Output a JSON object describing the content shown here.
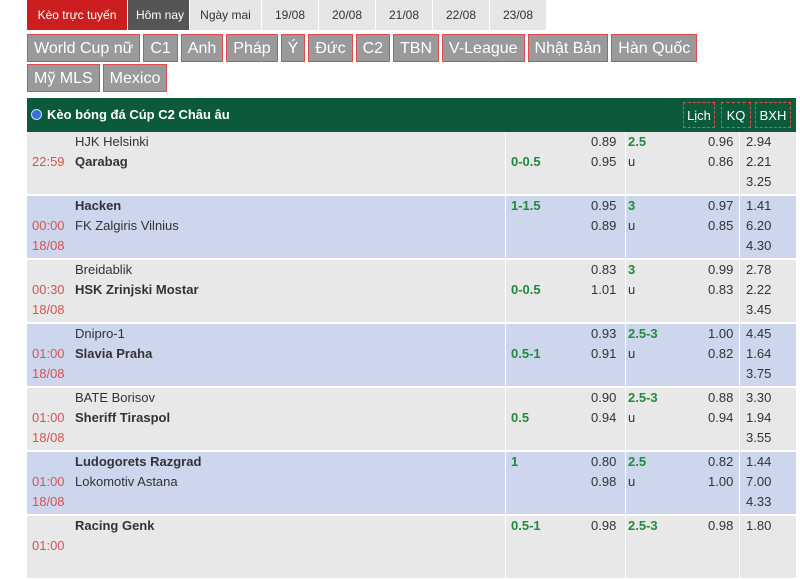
{
  "tabs": {
    "live": "Kèo trực tuyến",
    "today": "Hôm nay",
    "days": [
      "Ngày mai",
      "19/08",
      "20/08",
      "21/08",
      "22/08",
      "23/08"
    ]
  },
  "leagues": {
    "row1": [
      "World Cup nữ",
      "C1",
      "Anh",
      "Pháp",
      "Ý",
      "Đức",
      "C2",
      "TBN",
      "V-League",
      "Nhật Bản",
      "Hàn Quốc"
    ],
    "row2": [
      "Mỹ MLS",
      "Mexico"
    ]
  },
  "panel": {
    "title": "Kèo bóng đá Cúp C2 Châu âu",
    "buttons": {
      "schedule": "Lịch",
      "results": "KQ",
      "standings": "BXH"
    }
  },
  "matches": [
    {
      "time": "22:59",
      "date": "",
      "home": "HJK Helsinki",
      "away": "Qarabag",
      "home_bold": false,
      "away_bold": true,
      "handicap": "0-0.5",
      "handicap_row": 2,
      "h1": "0.89",
      "h2": "0.95",
      "ou": "2.5",
      "ou_u": "u",
      "o1": "0.96",
      "o2": "0.86",
      "x1": "2.94",
      "x2": "2.21",
      "x3": "3.25"
    },
    {
      "time": "00:00",
      "date": "18/08",
      "home": "Hacken",
      "away": "FK Zalgiris Vilnius",
      "home_bold": true,
      "away_bold": false,
      "handicap": "1-1.5",
      "handicap_row": 1,
      "h1": "0.95",
      "h2": "0.89",
      "ou": "3",
      "ou_u": "u",
      "o1": "0.97",
      "o2": "0.85",
      "x1": "1.41",
      "x2": "6.20",
      "x3": "4.30"
    },
    {
      "time": "00:30",
      "date": "18/08",
      "home": "Breidablik",
      "away": "HSK Zrinjski Mostar",
      "home_bold": false,
      "away_bold": true,
      "handicap": "0-0.5",
      "handicap_row": 2,
      "h1": "0.83",
      "h2": "1.01",
      "ou": "3",
      "ou_u": "u",
      "o1": "0.99",
      "o2": "0.83",
      "x1": "2.78",
      "x2": "2.22",
      "x3": "3.45"
    },
    {
      "time": "01:00",
      "date": "18/08",
      "home": "Dnipro-1",
      "away": "Slavia Praha",
      "home_bold": false,
      "away_bold": true,
      "handicap": "0.5-1",
      "handicap_row": 2,
      "h1": "0.93",
      "h2": "0.91",
      "ou": "2.5-3",
      "ou_u": "u",
      "o1": "1.00",
      "o2": "0.82",
      "x1": "4.45",
      "x2": "1.64",
      "x3": "3.75"
    },
    {
      "time": "01:00",
      "date": "18/08",
      "home": "BATE Borisov",
      "away": "Sheriff Tiraspol",
      "home_bold": false,
      "away_bold": true,
      "handicap": "0.5",
      "handicap_row": 2,
      "h1": "0.90",
      "h2": "0.94",
      "ou": "2.5-3",
      "ou_u": "u",
      "o1": "0.88",
      "o2": "0.94",
      "x1": "3.30",
      "x2": "1.94",
      "x3": "3.55"
    },
    {
      "time": "01:00",
      "date": "18/08",
      "home": "Ludogorets Razgrad",
      "away": "Lokomotiv Astana",
      "home_bold": true,
      "away_bold": false,
      "handicap": "1",
      "handicap_row": 1,
      "h1": "0.80",
      "h2": "0.98",
      "ou": "2.5",
      "ou_u": "u",
      "o1": "0.82",
      "o2": "1.00",
      "x1": "1.44",
      "x2": "7.00",
      "x3": "4.33"
    },
    {
      "time": "01:00",
      "date": "",
      "home": "Racing Genk",
      "away": "",
      "home_bold": true,
      "away_bold": false,
      "handicap": "0.5-1",
      "handicap_row": 1,
      "h1": "0.98",
      "h2": "",
      "ou": "2.5-3",
      "ou_u": "",
      "o1": "0.98",
      "o2": "",
      "x1": "1.80",
      "x2": "",
      "x3": ""
    }
  ]
}
